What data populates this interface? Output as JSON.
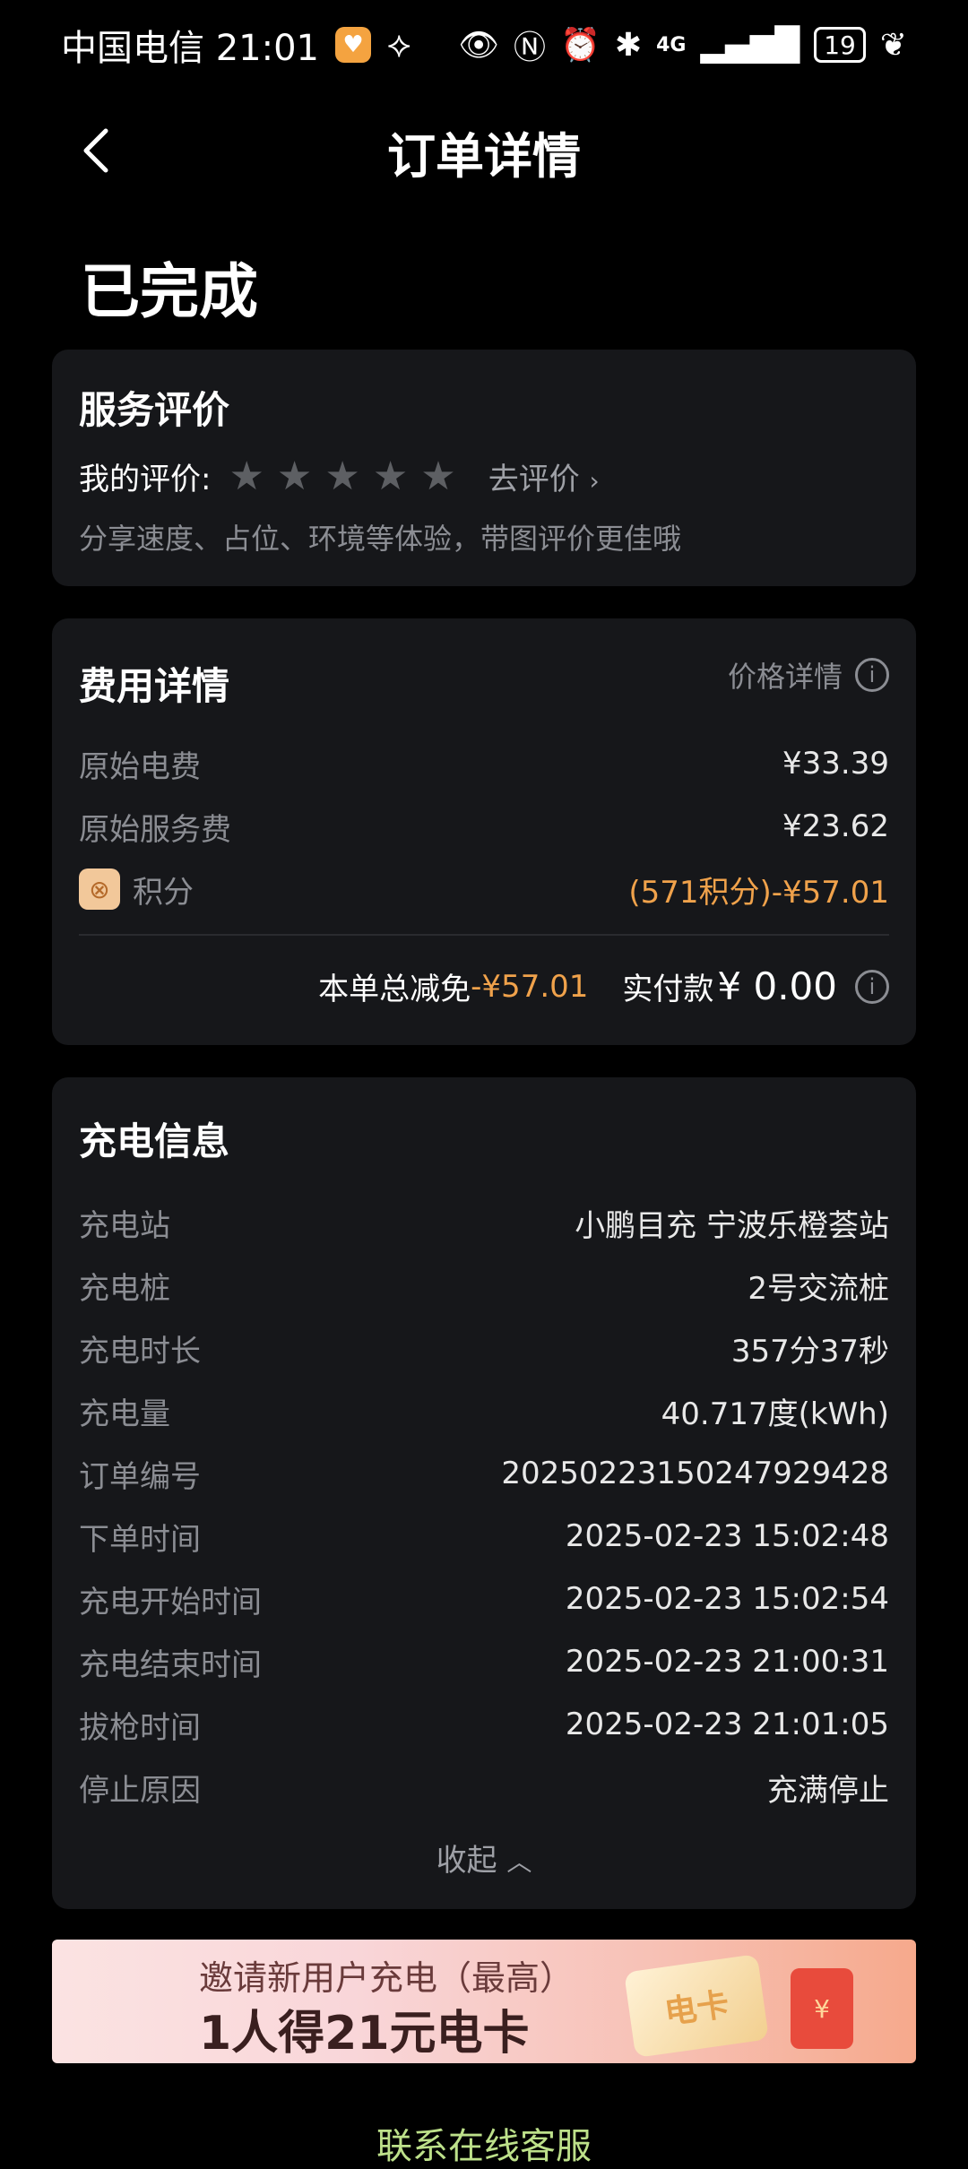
{
  "status_bar": {
    "carrier_time": "中国电信 21:01",
    "network": "4G",
    "battery": "19"
  },
  "nav": {
    "title": "订单详情"
  },
  "order": {
    "status": "已完成"
  },
  "review": {
    "title": "服务评价",
    "my_rating_label": "我的评价:",
    "stars": 5,
    "go_review": "去评价",
    "hint": "分享速度、占位、环境等体验，带图评价更佳哦"
  },
  "fees": {
    "title": "费用详情",
    "price_detail": "价格详情",
    "items": [
      {
        "label": "原始电费",
        "value": "¥33.39"
      },
      {
        "label": "原始服务费",
        "value": "¥23.62"
      }
    ],
    "points_label": "积分",
    "points_value": "(571积分)-¥57.01",
    "total_discount_label": "本单总减免",
    "total_discount_value": "-¥57.01",
    "paid_label": "实付款",
    "paid_value": "¥ 0.00"
  },
  "charging": {
    "title": "充电信息",
    "rows": [
      {
        "label": "充电站",
        "value": "小鹏目充 宁波乐橙荟站"
      },
      {
        "label": "充电桩",
        "value": "2号交流桩"
      },
      {
        "label": "充电时长",
        "value": "357分37秒"
      },
      {
        "label": "充电量",
        "value": "40.717度(kWh)"
      },
      {
        "label": "订单编号",
        "value": "20250223150247929428"
      },
      {
        "label": "下单时间",
        "value": "2025-02-23 15:02:48"
      },
      {
        "label": "充电开始时间",
        "value": "2025-02-23 15:02:54"
      },
      {
        "label": "充电结束时间",
        "value": "2025-02-23 21:00:31"
      },
      {
        "label": "拔枪时间",
        "value": "2025-02-23 21:01:05"
      },
      {
        "label": "停止原因",
        "value": "充满停止"
      }
    ],
    "collapse": "收起"
  },
  "banner": {
    "line1": "邀请新用户充电（最高）",
    "line2": "1人得21元电卡",
    "card_text": "电卡"
  },
  "contact": "联系在线客服"
}
